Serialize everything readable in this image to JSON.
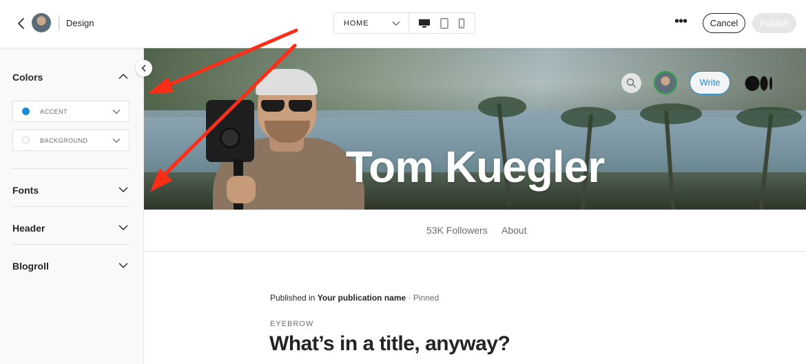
{
  "topbar": {
    "title": "Design",
    "page_select": "HOME",
    "cancel_label": "Cancel",
    "publish_label": "Publish",
    "more_glyph": "•••"
  },
  "sidebar": {
    "sections": [
      {
        "label": "Colors",
        "expanded": true
      },
      {
        "label": "Fonts",
        "expanded": false
      },
      {
        "label": "Header",
        "expanded": false
      },
      {
        "label": "Blogroll",
        "expanded": false
      }
    ],
    "color_fields": [
      {
        "label": "ACCENT",
        "color": "#1a8bd6"
      },
      {
        "label": "BACKGROUND",
        "color": "#ffffff"
      }
    ]
  },
  "preview": {
    "banner_title": "Tom Kuegler",
    "write_label": "Write",
    "nav": {
      "followers": "53K Followers",
      "about": "About"
    },
    "post": {
      "published_prefix": "Published in",
      "publication": "Your publication name",
      "pinned": "· Pinned",
      "eyebrow": "EYEBROW",
      "title": "What’s in a title, anyway?"
    }
  },
  "colors": {
    "accent": "#1a8bd6",
    "annotation_arrow": "#ff2d16",
    "publish_disabled": "#e6e6e6"
  }
}
